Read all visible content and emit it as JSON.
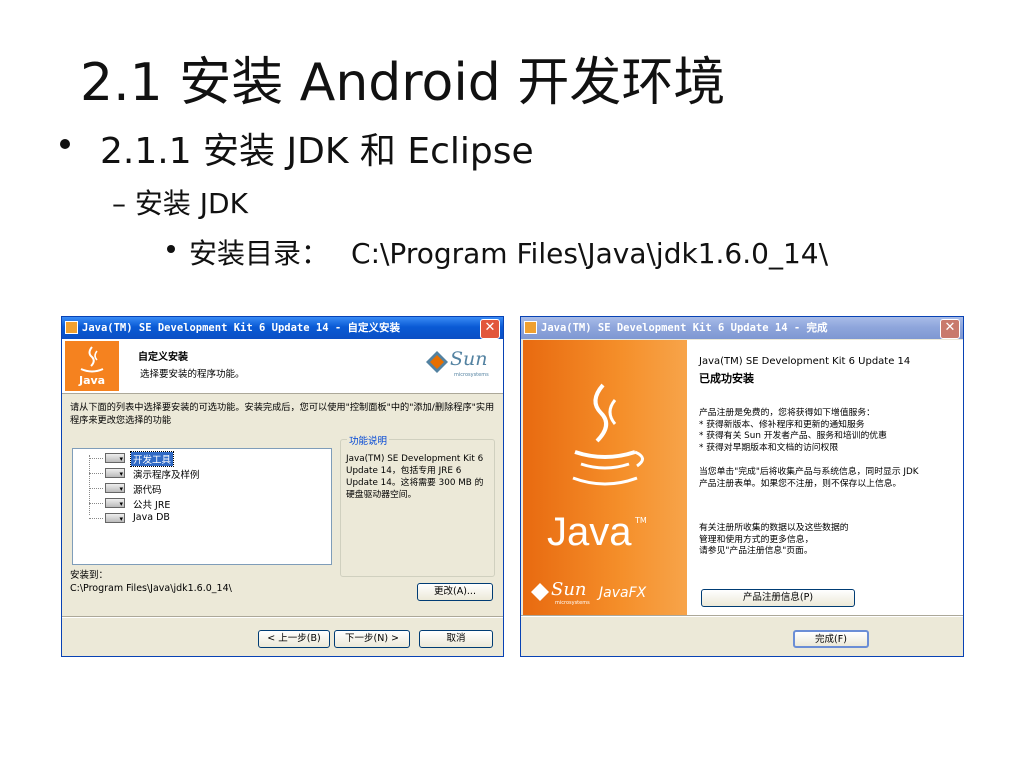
{
  "slide": {
    "title": "2.1  安装 Android 开发环境",
    "bullet1": "2.1.1  安装 JDK 和 Eclipse",
    "bullet2": "– 安装 JDK",
    "bullet3_label": "安装目录：",
    "bullet3_path": "C:\\Program Files\\Java\\jdk1.6.0_14\\"
  },
  "left_window": {
    "title": "Java(TM) SE Development Kit 6 Update 14 - 自定义安装",
    "close_glyph": "✕",
    "header_title": "自定义安装",
    "header_subtitle": "选择要安装的程序功能。",
    "java_logo_text": "Java",
    "sun_logo_text": "Sun",
    "sun_logo_sub": "microsystems",
    "instructions": "请从下面的列表中选择要安装的可选功能。安装完成后，您可以使用\"控制面板\"中的\"添加/删除程序\"实用程序来更改您选择的功能",
    "features": [
      "开发工具",
      "演示程序及样例",
      "源代码",
      "公共 JRE",
      "Java DB"
    ],
    "description_title": "功能说明",
    "description_text": "Java(TM) SE Development Kit 6 Update 14，包括专用 JRE 6 Update 14。这将需要 300 MB 的硬盘驱动器空间。",
    "install_to_label": "安装到：",
    "install_path": "C:\\Program Files\\Java\\jdk1.6.0_14\\",
    "change_button": "更改(A)...",
    "back_button": "< 上一步(B)",
    "next_button": "下一步(N) >",
    "cancel_button": "取消"
  },
  "right_window": {
    "title": "Java(TM) SE Development Kit 6 Update 14 - 完成",
    "close_glyph": "✕",
    "product_name": "Java(TM) SE Development Kit 6 Update 14",
    "success_text": "已成功安装",
    "java_logo_text": "Java",
    "java_logo_tm": "TM",
    "sun_logo_text": "Sun",
    "sun_logo_sub": "microsystems",
    "javafx_text": "JavaFX",
    "registration_lines": [
      "产品注册是免费的，您将获得如下增值服务：",
      "* 获得新版本、修补程序和更新的通知服务",
      "* 获得有关 Sun 开发者产品、服务和培训的优惠",
      "* 获得对早期版本和文档的访问权限"
    ],
    "finish_note_lines": [
      "当您单击\"完成\"后将收集产品与系统信息，同时显示 JDK",
      "产品注册表单。如果您不注册，则不保存以上信息。"
    ],
    "data_note_lines": [
      "有关注册所收集的数据以及这些数据的",
      "管理和使用方式的更多信息，",
      "请参见\"产品注册信息\"页面。"
    ],
    "registration_info_button": "产品注册信息(P)",
    "finish_button": "完成(F)"
  }
}
